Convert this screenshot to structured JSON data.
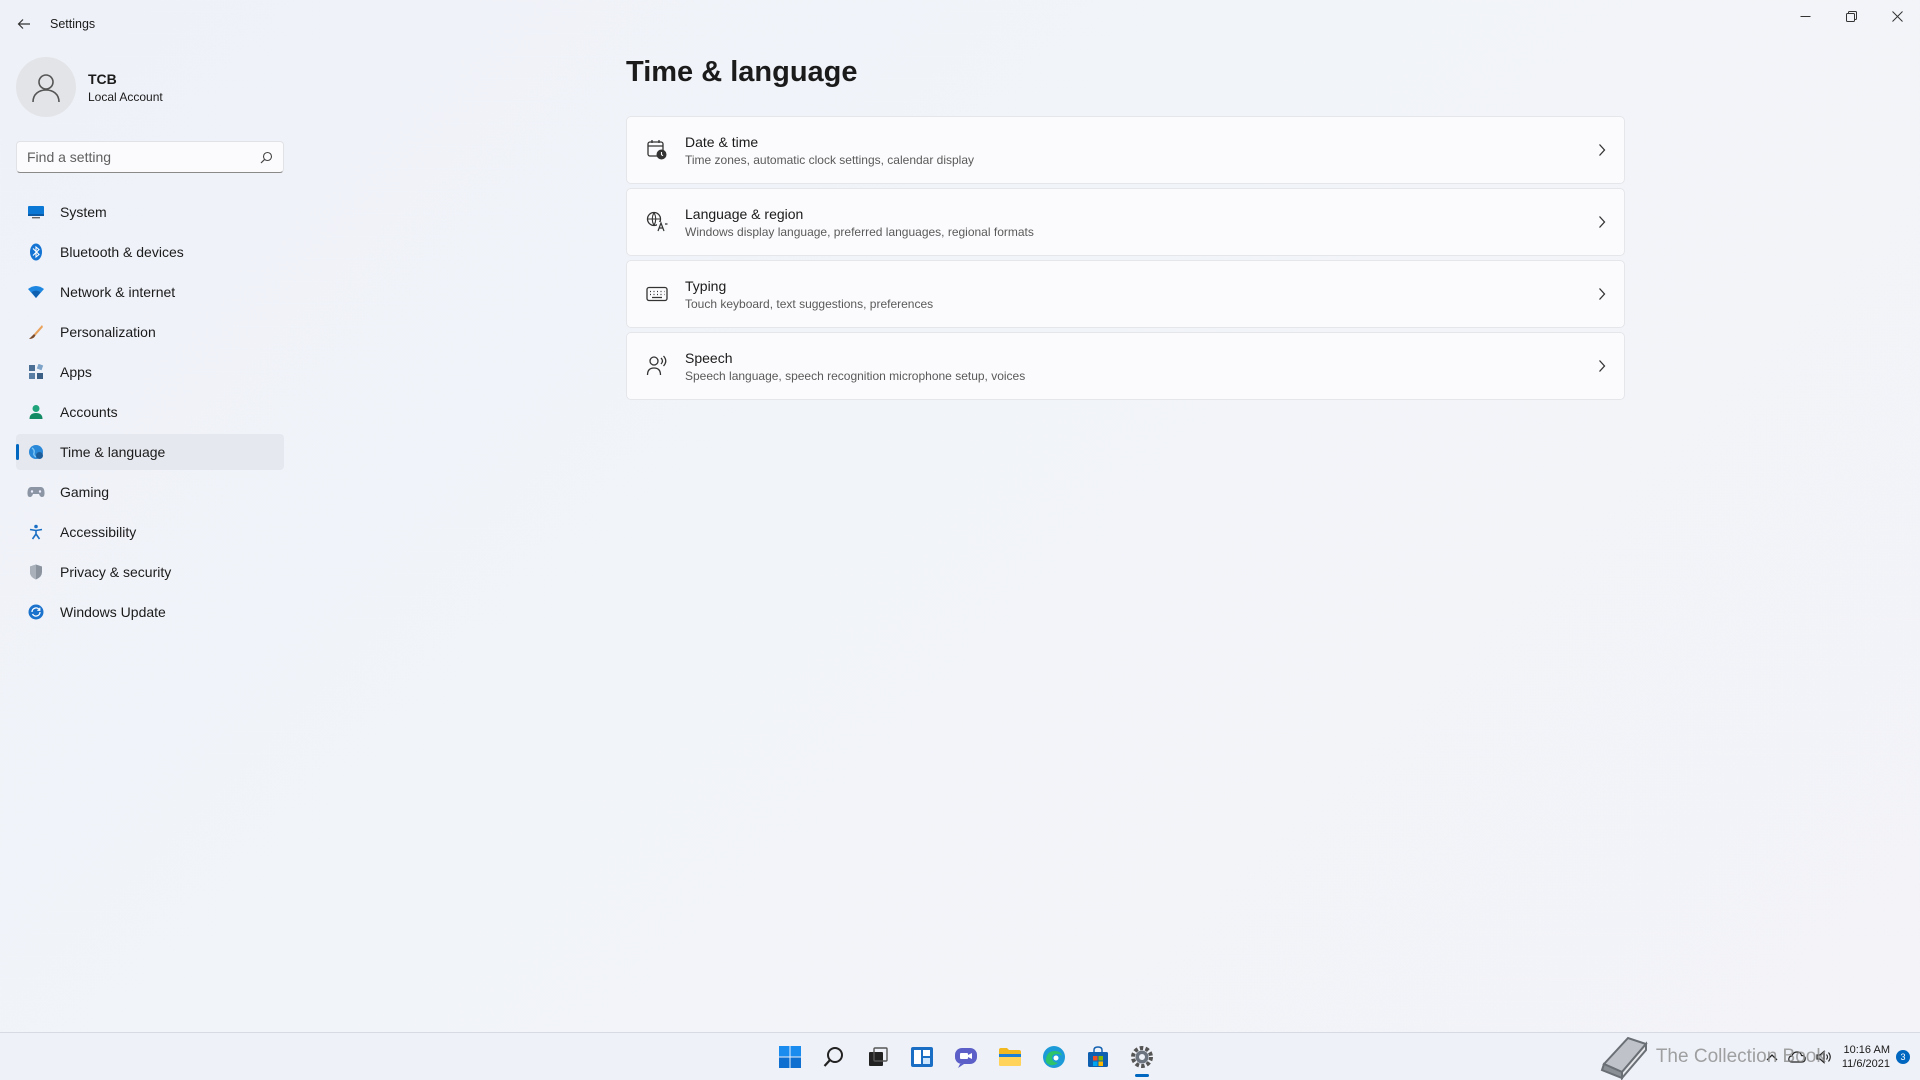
{
  "window": {
    "title": "Settings"
  },
  "profile": {
    "name": "TCB",
    "account_type": "Local Account"
  },
  "search": {
    "placeholder": "Find a setting",
    "value": ""
  },
  "sidebar": {
    "items": [
      {
        "label": "System",
        "icon": "monitor-icon"
      },
      {
        "label": "Bluetooth & devices",
        "icon": "bluetooth-icon"
      },
      {
        "label": "Network & internet",
        "icon": "wifi-icon"
      },
      {
        "label": "Personalization",
        "icon": "brush-icon"
      },
      {
        "label": "Apps",
        "icon": "apps-icon"
      },
      {
        "label": "Accounts",
        "icon": "person-icon"
      },
      {
        "label": "Time & language",
        "icon": "globe-clock-icon",
        "active": true
      },
      {
        "label": "Gaming",
        "icon": "controller-icon"
      },
      {
        "label": "Accessibility",
        "icon": "accessibility-icon"
      },
      {
        "label": "Privacy & security",
        "icon": "shield-icon"
      },
      {
        "label": "Windows Update",
        "icon": "update-icon"
      }
    ]
  },
  "main": {
    "title": "Time & language",
    "cards": [
      {
        "title": "Date & time",
        "desc": "Time zones, automatic clock settings, calendar display",
        "icon": "calendar-clock-icon"
      },
      {
        "title": "Language & region",
        "desc": "Windows display language, preferred languages, regional formats",
        "icon": "language-icon"
      },
      {
        "title": "Typing",
        "desc": "Touch keyboard, text suggestions, preferences",
        "icon": "keyboard-icon"
      },
      {
        "title": "Speech",
        "desc": "Speech language, speech recognition microphone setup, voices",
        "icon": "speech-icon"
      }
    ]
  },
  "taskbar": {
    "apps": [
      "start-icon",
      "search-icon",
      "task-view-icon",
      "widgets-icon",
      "chat-icon",
      "file-explorer-icon",
      "edge-icon",
      "store-icon",
      "settings-icon"
    ],
    "watermark": "The Collection Book",
    "time": "10:16 AM",
    "date": "11/6/2021",
    "notification_count": "3"
  },
  "colors": {
    "accent": "#0067c0",
    "background": "#f0f3f9"
  }
}
